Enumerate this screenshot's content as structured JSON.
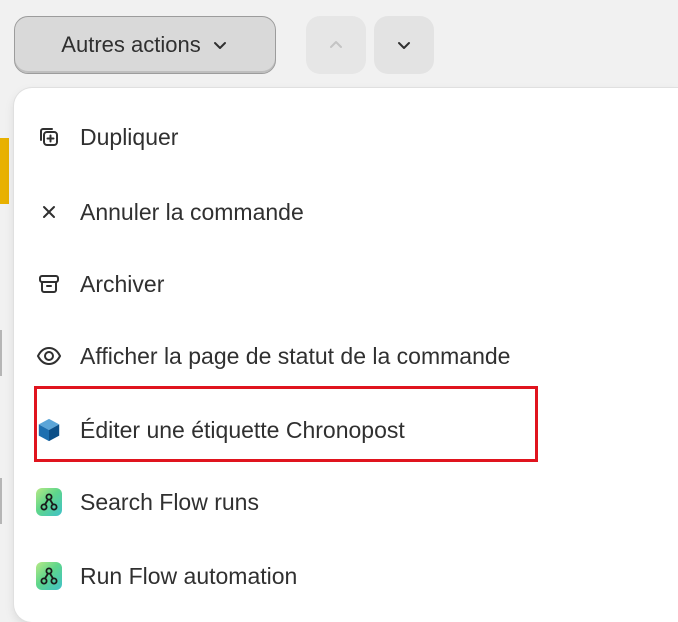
{
  "toolbar": {
    "more_actions_label": "Autres actions"
  },
  "menu": {
    "items": [
      {
        "label": "Dupliquer",
        "icon": "duplicate-icon"
      },
      {
        "label": "Annuler la commande",
        "icon": "close-icon"
      },
      {
        "label": "Archiver",
        "icon": "archive-icon"
      },
      {
        "label": "Afficher la page de statut de la commande",
        "icon": "eye-icon"
      },
      {
        "label": "Éditer une étiquette Chronopost",
        "icon": "chronopost-cube-icon"
      },
      {
        "label": "Search Flow runs",
        "icon": "flow-icon"
      },
      {
        "label": "Run Flow automation",
        "icon": "flow-icon"
      }
    ],
    "highlighted_item": "Éditer une étiquette Chronopost"
  },
  "colors": {
    "highlight_border": "#e0141e",
    "background": "#f1f1f1",
    "accent_yellow": "#e8b100"
  }
}
